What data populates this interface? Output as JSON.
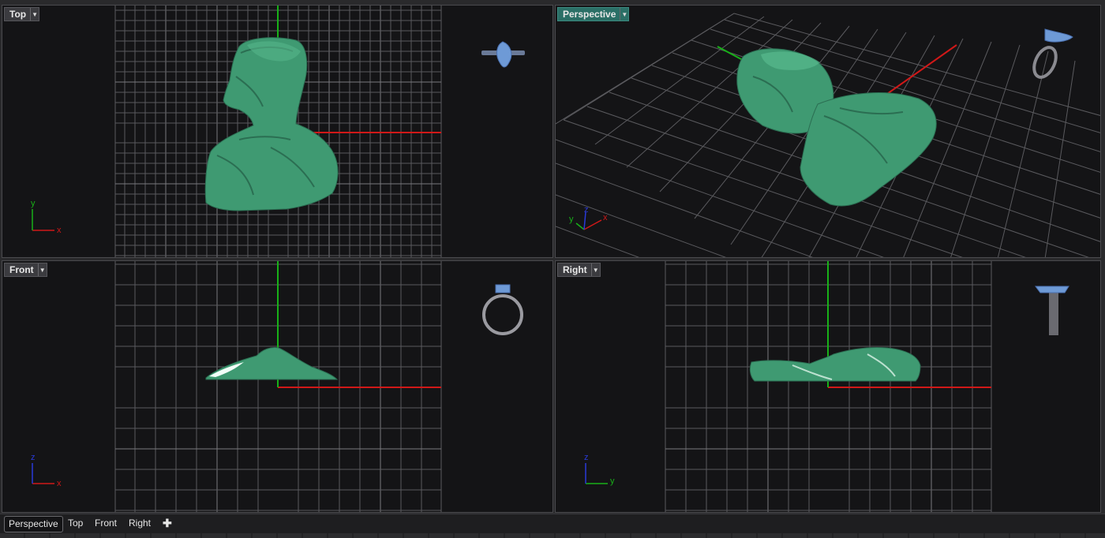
{
  "viewports": {
    "top": {
      "label": "Top",
      "axes": [
        "y",
        "x"
      ]
    },
    "perspective": {
      "label": "Perspective",
      "axes": [
        "y",
        "z",
        "x"
      ]
    },
    "front": {
      "label": "Front",
      "axes": [
        "z",
        "x"
      ]
    },
    "right": {
      "label": "Right",
      "axes": [
        "z",
        "y"
      ]
    }
  },
  "tabs": {
    "perspective": "Perspective",
    "top": "Top",
    "front": "Front",
    "right": "Right",
    "add": "✚"
  },
  "colors": {
    "background": "#141416",
    "grid": "#5a5a5e",
    "axis_x": "#d01818",
    "axis_y": "#18b018",
    "axis_z": "#2a3ad8",
    "model": "#3f9a72",
    "ring_stone": "#6e9ad6",
    "active_label": "#2b6f66"
  }
}
